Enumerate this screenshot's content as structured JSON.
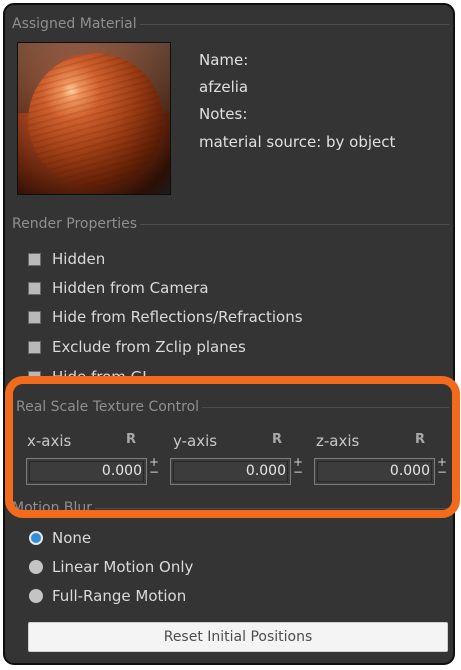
{
  "assigned_material": {
    "legend": "Assigned Material",
    "name_label": "Name:",
    "name_value": "afzelia",
    "notes_label": "Notes:",
    "notes_value": "material source: by object"
  },
  "render_properties": {
    "legend": "Render Properties",
    "items": [
      {
        "label": "Hidden",
        "checked": false
      },
      {
        "label": "Hidden from Camera",
        "checked": false
      },
      {
        "label": "Hide from Reflections/Refractions",
        "checked": false
      },
      {
        "label": "Exclude from Zclip planes",
        "checked": false
      },
      {
        "label": "Hide from GI",
        "checked": false
      }
    ]
  },
  "real_scale": {
    "legend": "Real Scale Texture Control",
    "axes": [
      {
        "label": "x-axis",
        "r": "R",
        "value": "0.000"
      },
      {
        "label": "y-axis",
        "r": "R",
        "value": "0.000"
      },
      {
        "label": "z-axis",
        "r": "R",
        "value": "0.000"
      }
    ],
    "spin_plus": "+",
    "spin_minus": "−"
  },
  "motion_blur": {
    "legend": "Motion Blur",
    "options": [
      {
        "label": "None",
        "selected": true
      },
      {
        "label": "Linear Motion Only",
        "selected": false
      },
      {
        "label": "Full-Range Motion",
        "selected": false
      }
    ],
    "reset_label": "Reset Initial Positions"
  },
  "colors": {
    "panel_bg": "#343434",
    "highlight": "#f26a1b",
    "radio_selected": "#2f8fd8"
  }
}
